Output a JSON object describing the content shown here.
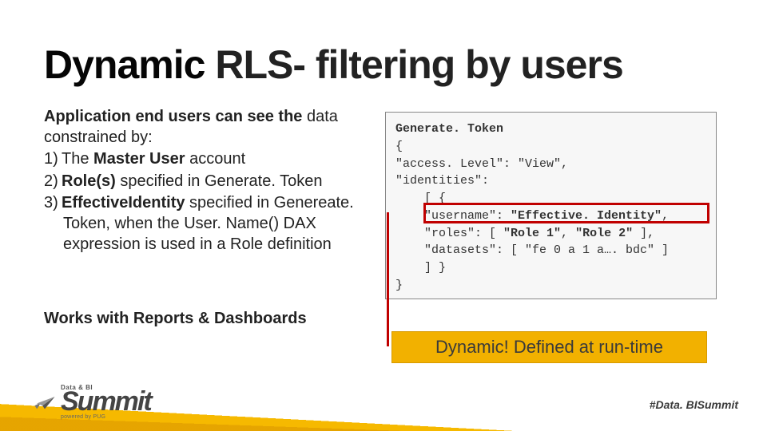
{
  "title_pre": "Dynamic",
  "title_rest": " RLS- filtering by users",
  "lead_bold": "Application end users can see the",
  "lead_rest": "data constrained by:",
  "items": [
    {
      "num": "1)",
      "pre": "The ",
      "bold": "Master User ",
      "post": "account"
    },
    {
      "num": "2)",
      "pre": "",
      "bold": "Role(s) ",
      "post": "specified in Generate. Token"
    },
    {
      "num": "3)",
      "pre": "",
      "bold": "EffectiveIdentity ",
      "post": "specified in Genereate. Token, when the User. Name() DAX expression is used in a Role definition"
    }
  ],
  "works": "Works with Reports & Dashboards",
  "code": {
    "l1": "Generate. Token",
    "l2": "{",
    "l3": "\"access. Level\": \"View\",",
    "l4": "\"identities\":",
    "l5": "    [ {",
    "l6_key": "    \"username\": ",
    "l6_val": "\"Effective. Identity\"",
    "l6_end": ",",
    "l7_key": "    \"roles\": [ ",
    "l7_v1": "\"Role 1\"",
    "l7_mid": ", ",
    "l7_v2": "\"Role 2\"",
    "l7_end": " ],",
    "l8": "    \"datasets\": [ \"fe 0 a 1 a…. bdc\" ]",
    "l9": "    ] }",
    "l10": "}"
  },
  "callout": "Dynamic! Defined at run-time",
  "hashtag": "#Data. BISummit",
  "logo_small_top": "Data & BI",
  "logo_big": "Summit",
  "logo_sub": "powered by PUG"
}
